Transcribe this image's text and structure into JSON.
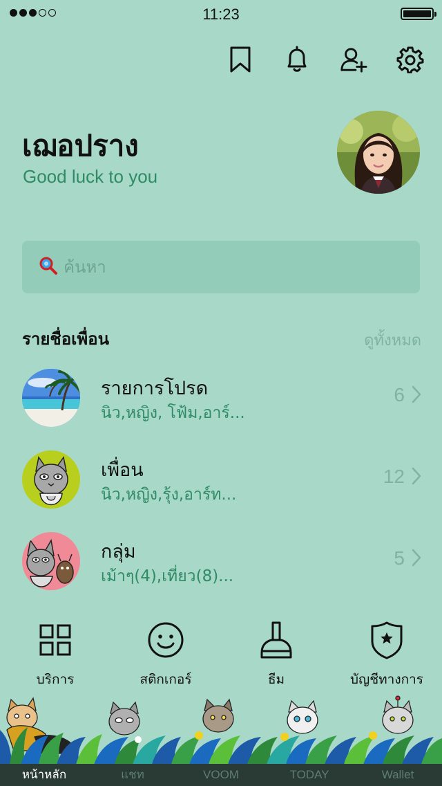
{
  "status_bar": {
    "time": "11:23",
    "signal_dots_filled": 3,
    "signal_dots_total": 5,
    "battery_level": 1.0
  },
  "header_icons": [
    "bookmark-icon",
    "bell-icon",
    "add-friend-icon",
    "gear-icon"
  ],
  "profile": {
    "name": "เฌอปราง",
    "status_message": "Good luck to you"
  },
  "search": {
    "placeholder": "ค้นหา"
  },
  "friends_section": {
    "title": "รายชื่อเพื่อน",
    "see_all": "ดูทั้งหมด",
    "rows": [
      {
        "title": "รายการโปรด",
        "subtitle": "นิว,หญิง, โฟ้ม,อาร์...",
        "count": "6"
      },
      {
        "title": "เพื่อน",
        "subtitle": "นิว,หญิง,รุ้ง,อาร์ท...",
        "count": "12"
      },
      {
        "title": "กลุ่ม",
        "subtitle": "เม้าๆ(4),เที่ยว(8)...",
        "count": "5"
      }
    ]
  },
  "tools": [
    {
      "label": "บริการ",
      "icon": "grid-icon"
    },
    {
      "label": "สติกเกอร์",
      "icon": "smiley-icon"
    },
    {
      "label": "ธีม",
      "icon": "brush-icon"
    },
    {
      "label": "บัญชีทางการ",
      "icon": "shield-star-icon"
    }
  ],
  "tabs": [
    {
      "label": "หน้าหลัก",
      "active": true
    },
    {
      "label": "แชท",
      "active": false
    },
    {
      "label": "VOOM",
      "active": false
    },
    {
      "label": "TODAY",
      "active": false
    },
    {
      "label": "Wallet",
      "active": false
    }
  ],
  "colors": {
    "background": "#a8d8c8",
    "accent_text": "#2e8b66",
    "muted_text": "#7fb3a2",
    "tabbar": "#2a3a35"
  }
}
